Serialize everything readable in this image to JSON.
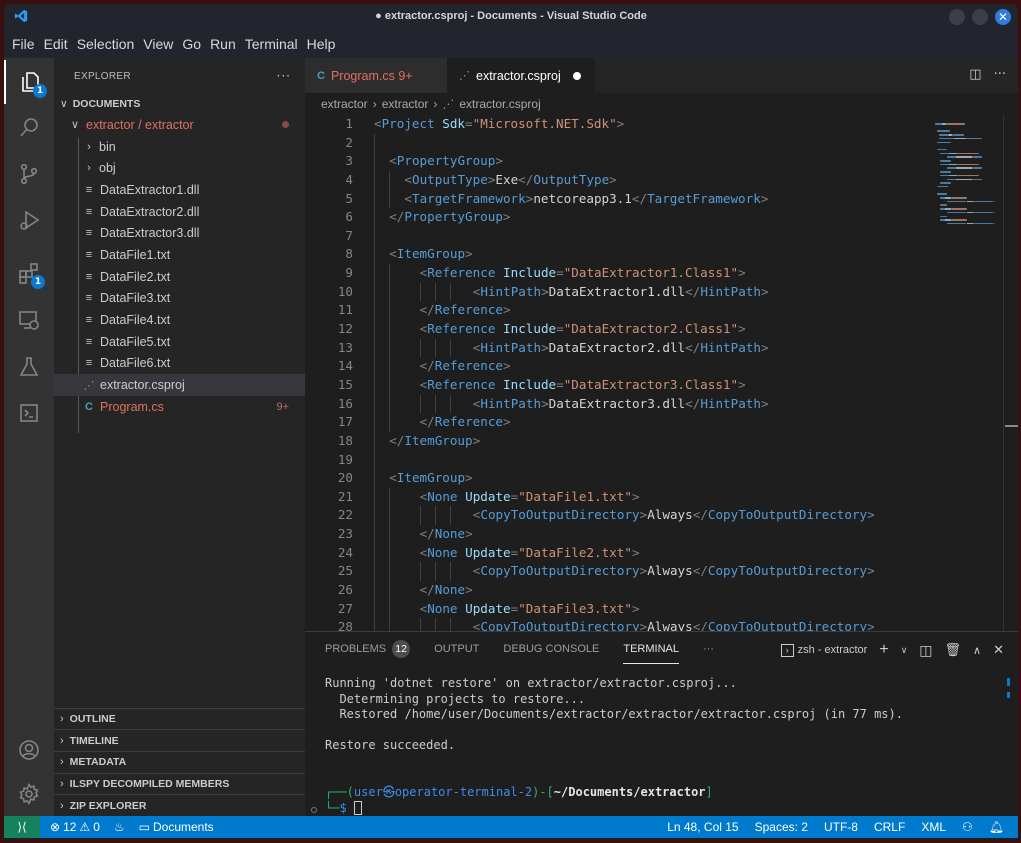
{
  "window": {
    "title": "● extractor.csproj - Documents - Visual Studio Code",
    "close_glyph": "✕"
  },
  "menu": [
    "File",
    "Edit",
    "Selection",
    "View",
    "Go",
    "Run",
    "Terminal",
    "Help"
  ],
  "activity_bar": {
    "explorer_badge": "1",
    "extensions_badge": "1"
  },
  "sidebar": {
    "header": "EXPLORER",
    "more": "···",
    "root_section": "DOCUMENTS",
    "folder": "extractor / extractor",
    "items": [
      {
        "label": "bin",
        "kind": "folder"
      },
      {
        "label": "obj",
        "kind": "folder"
      },
      {
        "label": "DataExtractor1.dll",
        "kind": "file"
      },
      {
        "label": "DataExtractor2.dll",
        "kind": "file"
      },
      {
        "label": "DataExtractor3.dll",
        "kind": "file"
      },
      {
        "label": "DataFile1.txt",
        "kind": "file"
      },
      {
        "label": "DataFile2.txt",
        "kind": "file"
      },
      {
        "label": "DataFile3.txt",
        "kind": "file"
      },
      {
        "label": "DataFile4.txt",
        "kind": "file"
      },
      {
        "label": "DataFile5.txt",
        "kind": "file"
      },
      {
        "label": "DataFile6.txt",
        "kind": "file"
      },
      {
        "label": "extractor.csproj",
        "kind": "rss",
        "selected": true
      },
      {
        "label": "Program.cs",
        "kind": "csharp",
        "badge": "9+"
      }
    ],
    "panels": [
      "OUTLINE",
      "TIMELINE",
      "METADATA",
      "ILSPY DECOMPILED MEMBERS",
      "ZIP EXPLORER"
    ]
  },
  "tabs": [
    {
      "label": "Program.cs 9+",
      "active": false
    },
    {
      "label": "extractor.csproj",
      "active": true
    }
  ],
  "breadcrumb": [
    "extractor",
    "extractor",
    "extractor.csproj"
  ],
  "editor": {
    "lines": [
      {
        "n": "1",
        "indent": 0,
        "tokens": [
          [
            "br",
            "<"
          ],
          [
            "tag",
            "Project"
          ],
          [
            "text",
            " "
          ],
          [
            "attr",
            "Sdk"
          ],
          [
            "br",
            "="
          ],
          [
            "str",
            "\"Microsoft.NET.Sdk\""
          ],
          [
            "br",
            ">"
          ]
        ]
      },
      {
        "n": "2",
        "indent": 0,
        "tokens": []
      },
      {
        "n": "3",
        "indent": 1,
        "tokens": [
          [
            "br",
            "<"
          ],
          [
            "tag",
            "PropertyGroup"
          ],
          [
            "br",
            ">"
          ]
        ]
      },
      {
        "n": "4",
        "indent": 2,
        "tokens": [
          [
            "br",
            "<"
          ],
          [
            "tag",
            "OutputType"
          ],
          [
            "br",
            ">"
          ],
          [
            "text",
            "Exe"
          ],
          [
            "br",
            "</"
          ],
          [
            "tag",
            "OutputType"
          ],
          [
            "br",
            ">"
          ]
        ]
      },
      {
        "n": "5",
        "indent": 2,
        "tokens": [
          [
            "br",
            "<"
          ],
          [
            "tag",
            "TargetFramework"
          ],
          [
            "br",
            ">"
          ],
          [
            "text",
            "netcoreapp3.1"
          ],
          [
            "br",
            "</"
          ],
          [
            "tag",
            "TargetFramework"
          ],
          [
            "br",
            ">"
          ]
        ]
      },
      {
        "n": "6",
        "indent": 1,
        "tokens": [
          [
            "br",
            "</"
          ],
          [
            "tag",
            "PropertyGroup"
          ],
          [
            "br",
            ">"
          ]
        ]
      },
      {
        "n": "7",
        "indent": 0,
        "tokens": []
      },
      {
        "n": "8",
        "indent": 1,
        "tokens": [
          [
            "br",
            "<"
          ],
          [
            "tag",
            "ItemGroup"
          ],
          [
            "br",
            ">"
          ]
        ]
      },
      {
        "n": "9",
        "indent": 3,
        "tokens": [
          [
            "br",
            "<"
          ],
          [
            "tag",
            "Reference"
          ],
          [
            "text",
            " "
          ],
          [
            "attr",
            "Include"
          ],
          [
            "br",
            "="
          ],
          [
            "str",
            "\"DataExtractor1.Class1\""
          ],
          [
            "br",
            ">"
          ]
        ]
      },
      {
        "n": "10",
        "indent": 6,
        "tokens": [
          [
            "br",
            "<"
          ],
          [
            "tag",
            "HintPath"
          ],
          [
            "br",
            ">"
          ],
          [
            "text",
            "DataExtractor1.dll"
          ],
          [
            "br",
            "</"
          ],
          [
            "tag",
            "HintPath"
          ],
          [
            "br",
            ">"
          ]
        ]
      },
      {
        "n": "11",
        "indent": 3,
        "tokens": [
          [
            "br",
            "</"
          ],
          [
            "tag",
            "Reference"
          ],
          [
            "br",
            ">"
          ]
        ]
      },
      {
        "n": "12",
        "indent": 3,
        "tokens": [
          [
            "br",
            "<"
          ],
          [
            "tag",
            "Reference"
          ],
          [
            "text",
            " "
          ],
          [
            "attr",
            "Include"
          ],
          [
            "br",
            "="
          ],
          [
            "str",
            "\"DataExtractor2.Class1\""
          ],
          [
            "br",
            ">"
          ]
        ]
      },
      {
        "n": "13",
        "indent": 6,
        "tokens": [
          [
            "br",
            "<"
          ],
          [
            "tag",
            "HintPath"
          ],
          [
            "br",
            ">"
          ],
          [
            "text",
            "DataExtractor2.dll"
          ],
          [
            "br",
            "</"
          ],
          [
            "tag",
            "HintPath"
          ],
          [
            "br",
            ">"
          ]
        ]
      },
      {
        "n": "14",
        "indent": 3,
        "tokens": [
          [
            "br",
            "</"
          ],
          [
            "tag",
            "Reference"
          ],
          [
            "br",
            ">"
          ]
        ]
      },
      {
        "n": "15",
        "indent": 3,
        "tokens": [
          [
            "br",
            "<"
          ],
          [
            "tag",
            "Reference"
          ],
          [
            "text",
            " "
          ],
          [
            "attr",
            "Include"
          ],
          [
            "br",
            "="
          ],
          [
            "str",
            "\"DataExtractor3.Class1\""
          ],
          [
            "br",
            ">"
          ]
        ]
      },
      {
        "n": "16",
        "indent": 6,
        "tokens": [
          [
            "br",
            "<"
          ],
          [
            "tag",
            "HintPath"
          ],
          [
            "br",
            ">"
          ],
          [
            "text",
            "DataExtractor3.dll"
          ],
          [
            "br",
            "</"
          ],
          [
            "tag",
            "HintPath"
          ],
          [
            "br",
            ">"
          ]
        ]
      },
      {
        "n": "17",
        "indent": 3,
        "tokens": [
          [
            "br",
            "</"
          ],
          [
            "tag",
            "Reference"
          ],
          [
            "br",
            ">"
          ]
        ]
      },
      {
        "n": "18",
        "indent": 1,
        "tokens": [
          [
            "br",
            "</"
          ],
          [
            "tag",
            "ItemGroup"
          ],
          [
            "br",
            ">"
          ]
        ]
      },
      {
        "n": "19",
        "indent": 0,
        "tokens": []
      },
      {
        "n": "20",
        "indent": 1,
        "tokens": [
          [
            "br",
            "<"
          ],
          [
            "tag",
            "ItemGroup"
          ],
          [
            "br",
            ">"
          ]
        ]
      },
      {
        "n": "21",
        "indent": 3,
        "tokens": [
          [
            "br",
            "<"
          ],
          [
            "tag",
            "None"
          ],
          [
            "text",
            " "
          ],
          [
            "attr",
            "Update"
          ],
          [
            "br",
            "="
          ],
          [
            "str",
            "\"DataFile1.txt\""
          ],
          [
            "br",
            ">"
          ]
        ]
      },
      {
        "n": "22",
        "indent": 6,
        "tokens": [
          [
            "br",
            "<"
          ],
          [
            "tag",
            "CopyToOutputDirectory"
          ],
          [
            "br",
            ">"
          ],
          [
            "text",
            "Always"
          ],
          [
            "br",
            "</"
          ],
          [
            "tag",
            "CopyToOutputDirectory"
          ],
          [
            "br",
            ">"
          ]
        ]
      },
      {
        "n": "23",
        "indent": 3,
        "tokens": [
          [
            "br",
            "</"
          ],
          [
            "tag",
            "None"
          ],
          [
            "br",
            ">"
          ]
        ]
      },
      {
        "n": "24",
        "indent": 3,
        "tokens": [
          [
            "br",
            "<"
          ],
          [
            "tag",
            "None"
          ],
          [
            "text",
            " "
          ],
          [
            "attr",
            "Update"
          ],
          [
            "br",
            "="
          ],
          [
            "str",
            "\"DataFile2.txt\""
          ],
          [
            "br",
            ">"
          ]
        ]
      },
      {
        "n": "25",
        "indent": 6,
        "tokens": [
          [
            "br",
            "<"
          ],
          [
            "tag",
            "CopyToOutputDirectory"
          ],
          [
            "br",
            ">"
          ],
          [
            "text",
            "Always"
          ],
          [
            "br",
            "</"
          ],
          [
            "tag",
            "CopyToOutputDirectory"
          ],
          [
            "br",
            ">"
          ]
        ]
      },
      {
        "n": "26",
        "indent": 3,
        "tokens": [
          [
            "br",
            "</"
          ],
          [
            "tag",
            "None"
          ],
          [
            "br",
            ">"
          ]
        ]
      },
      {
        "n": "27",
        "indent": 3,
        "tokens": [
          [
            "br",
            "<"
          ],
          [
            "tag",
            "None"
          ],
          [
            "text",
            " "
          ],
          [
            "attr",
            "Update"
          ],
          [
            "br",
            "="
          ],
          [
            "str",
            "\"DataFile3.txt\""
          ],
          [
            "br",
            ">"
          ]
        ]
      },
      {
        "n": "28",
        "indent": 6,
        "tokens": [
          [
            "br",
            "<"
          ],
          [
            "tag",
            "CopyToOutputDirectory"
          ],
          [
            "br",
            ">"
          ],
          [
            "text",
            "Always"
          ],
          [
            "br",
            "</"
          ],
          [
            "tag",
            "CopyToOutputDirectory"
          ],
          [
            "br",
            ">"
          ]
        ]
      }
    ]
  },
  "panel": {
    "tabs": [
      {
        "label": "PROBLEMS",
        "badge": "12"
      },
      {
        "label": "OUTPUT"
      },
      {
        "label": "DEBUG CONSOLE"
      },
      {
        "label": "TERMINAL",
        "active": true
      }
    ],
    "more": "···",
    "terminal_name": "zsh - extractor",
    "terminal": {
      "line1": "Running 'dotnet restore' on extractor/extractor.csproj...",
      "line2": "  Determining projects to restore...",
      "line3": "  Restored /home/user/Documents/extractor/extractor/extractor.csproj (in 77 ms).",
      "line4": "Restore succeeded.",
      "prompt_user": "user",
      "prompt_at": "㉿",
      "prompt_host": "operator-terminal-2",
      "prompt_path": "~/Documents/extractor",
      "prompt_symbol": "$"
    }
  },
  "statusbar": {
    "errors": "12",
    "warnings": "0",
    "folder": "Documents",
    "position": "Ln 48, Col 15",
    "spaces": "Spaces: 2",
    "encoding": "UTF-8",
    "eol": "CRLF",
    "language": "XML"
  },
  "colors": {
    "accent": "#007acc",
    "remote": "#16825d",
    "modified": "#e2705f",
    "tag": "#569cd6",
    "attr": "#9cdcfe",
    "string": "#ce9178"
  }
}
